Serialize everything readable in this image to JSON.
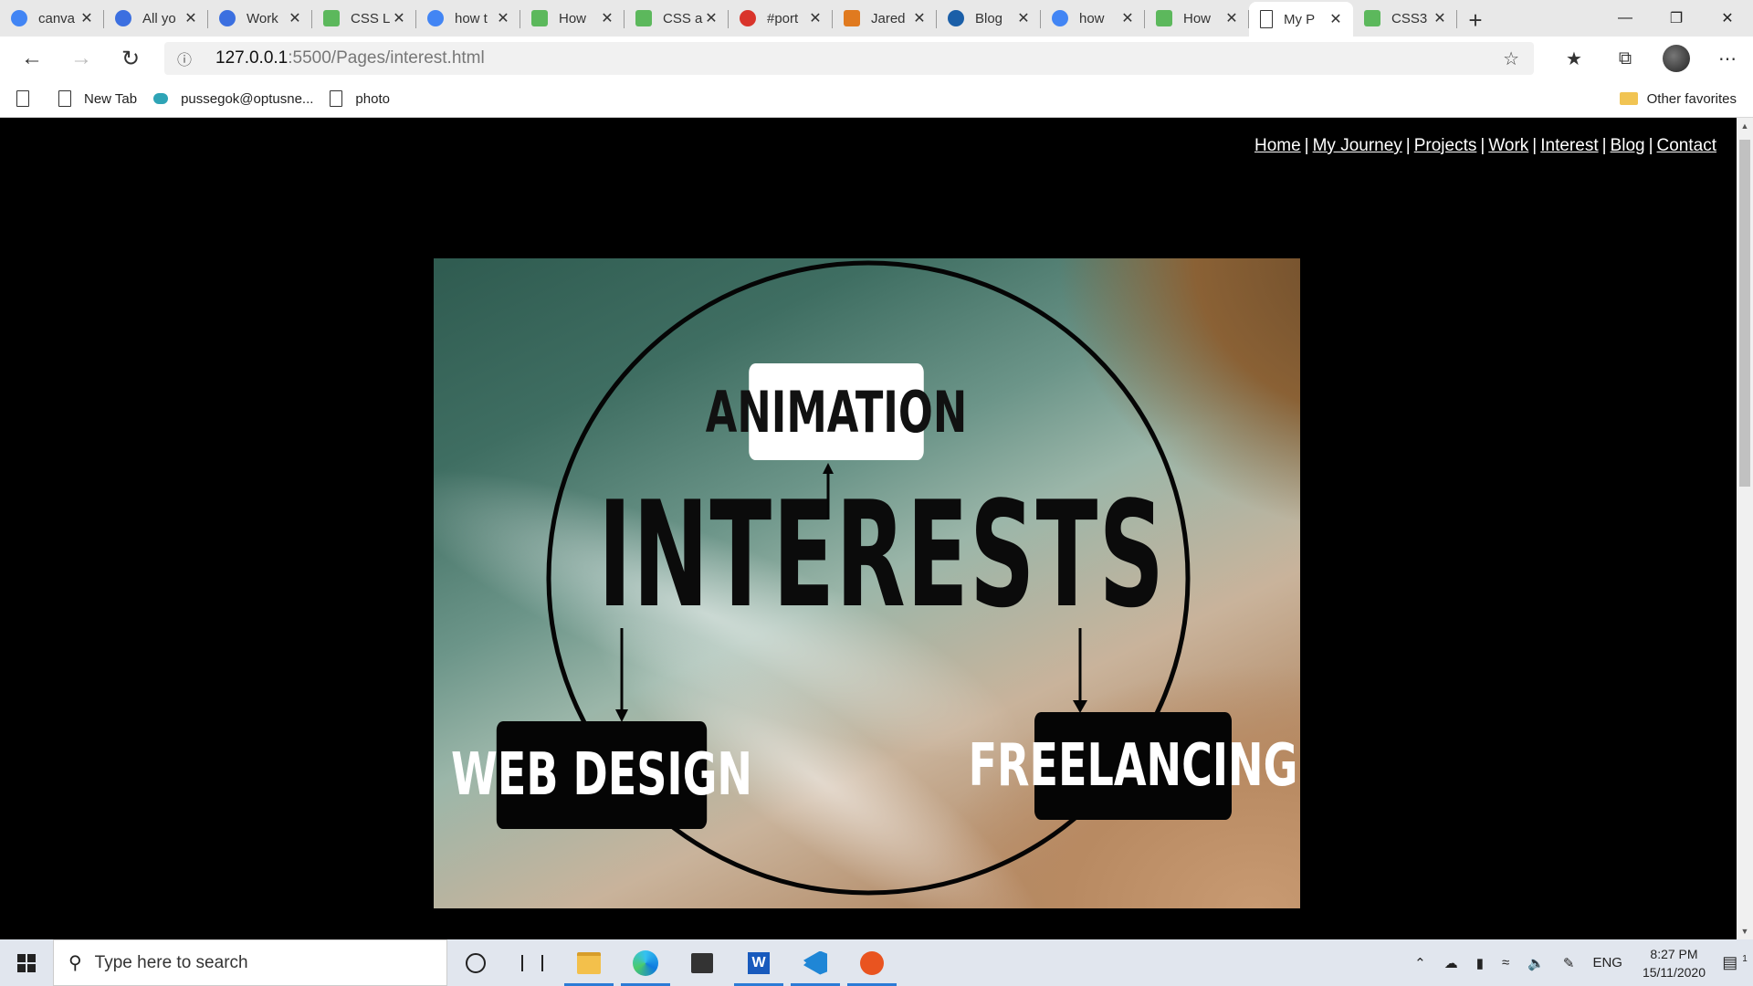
{
  "tabs": [
    {
      "title": "canva",
      "favicon": "google-icon",
      "color": "#4285f4"
    },
    {
      "title": "All yo",
      "favicon": "c-icon",
      "color": "#3b6fe0"
    },
    {
      "title": "Work",
      "favicon": "c-icon",
      "color": "#3b6fe0"
    },
    {
      "title": "CSS L",
      "favicon": "w3schools-icon",
      "color": "#5cb85c"
    },
    {
      "title": "how t",
      "favicon": "google-icon",
      "color": "#4285f4"
    },
    {
      "title": "How",
      "favicon": "w3schools-icon",
      "color": "#5cb85c"
    },
    {
      "title": "CSS a",
      "favicon": "w3schools-icon",
      "color": "#5cb85c"
    },
    {
      "title": "#port",
      "favicon": "app-icon",
      "color": "#d9342b"
    },
    {
      "title": "Jared",
      "favicon": "jb-icon",
      "color": "#e07a1f"
    },
    {
      "title": "Blog",
      "favicon": "dot-icon",
      "color": "#1b5fa8"
    },
    {
      "title": "how",
      "favicon": "google-icon",
      "color": "#4285f4"
    },
    {
      "title": "How",
      "favicon": "w3schools-icon",
      "color": "#5cb85c"
    },
    {
      "title": "My P",
      "favicon": "page-icon",
      "color": "#ffffff",
      "active": true
    },
    {
      "title": "CSS3",
      "favicon": "w3schools-icon",
      "color": "#5cb85c"
    }
  ],
  "address": {
    "host": "127.0.0.1",
    "path": ":5500/Pages/interest.html"
  },
  "bookmarks": [
    {
      "label": "",
      "icon": "page-icon"
    },
    {
      "label": "New Tab",
      "icon": "page-icon"
    },
    {
      "label": "pussegok@optusne...",
      "icon": "cloud-icon"
    },
    {
      "label": "photo",
      "icon": "page-icon"
    }
  ],
  "other_favorites": "Other favorites",
  "site_nav": [
    "Home",
    "My Journey",
    "Projects",
    "Work",
    "Interest",
    "Blog",
    "Contact"
  ],
  "hero": {
    "title": "INTERESTS",
    "top_label": "ANIMATION",
    "left_label": "WEB DESIGN",
    "right_label": "FREELANCING"
  },
  "taskbar": {
    "search_placeholder": "Type here to search",
    "language": "ENG",
    "time": "8:27 PM",
    "date": "15/11/2020",
    "notifications": "1"
  }
}
